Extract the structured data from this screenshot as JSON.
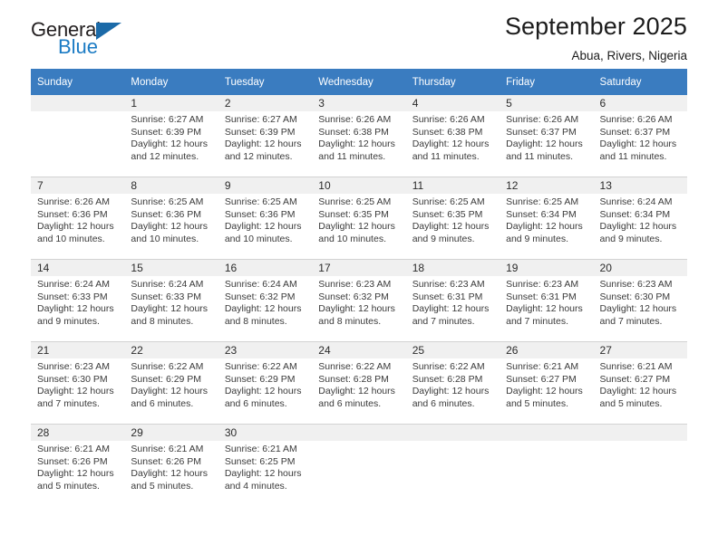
{
  "brand": {
    "name_top": "General",
    "name_bottom": "Blue",
    "accent_color": "#1b7bc4",
    "triangle_color": "#1b6aa8"
  },
  "header": {
    "title": "September 2025",
    "subtitle": "Abua, Rivers, Nigeria"
  },
  "theme": {
    "header_row_color": "#3a7cc0",
    "daynum_band_color": "#f0f0f0",
    "grid_line_color": "#d2d2d2",
    "text_color": "#2b2b2b"
  },
  "weekday_headers": [
    "Sunday",
    "Monday",
    "Tuesday",
    "Wednesday",
    "Thursday",
    "Friday",
    "Saturday"
  ],
  "labels": {
    "sunrise_prefix": "Sunrise:",
    "sunset_prefix": "Sunset:",
    "daylight_prefix": "Daylight:"
  },
  "weeks": [
    [
      {
        "day": "",
        "sunrise": "",
        "sunset": "",
        "daylight_line1": "",
        "daylight_line2": ""
      },
      {
        "day": "1",
        "sunrise": "Sunrise: 6:27 AM",
        "sunset": "Sunset: 6:39 PM",
        "daylight_line1": "Daylight: 12 hours",
        "daylight_line2": "and 12 minutes."
      },
      {
        "day": "2",
        "sunrise": "Sunrise: 6:27 AM",
        "sunset": "Sunset: 6:39 PM",
        "daylight_line1": "Daylight: 12 hours",
        "daylight_line2": "and 12 minutes."
      },
      {
        "day": "3",
        "sunrise": "Sunrise: 6:26 AM",
        "sunset": "Sunset: 6:38 PM",
        "daylight_line1": "Daylight: 12 hours",
        "daylight_line2": "and 11 minutes."
      },
      {
        "day": "4",
        "sunrise": "Sunrise: 6:26 AM",
        "sunset": "Sunset: 6:38 PM",
        "daylight_line1": "Daylight: 12 hours",
        "daylight_line2": "and 11 minutes."
      },
      {
        "day": "5",
        "sunrise": "Sunrise: 6:26 AM",
        "sunset": "Sunset: 6:37 PM",
        "daylight_line1": "Daylight: 12 hours",
        "daylight_line2": "and 11 minutes."
      },
      {
        "day": "6",
        "sunrise": "Sunrise: 6:26 AM",
        "sunset": "Sunset: 6:37 PM",
        "daylight_line1": "Daylight: 12 hours",
        "daylight_line2": "and 11 minutes."
      }
    ],
    [
      {
        "day": "7",
        "sunrise": "Sunrise: 6:26 AM",
        "sunset": "Sunset: 6:36 PM",
        "daylight_line1": "Daylight: 12 hours",
        "daylight_line2": "and 10 minutes."
      },
      {
        "day": "8",
        "sunrise": "Sunrise: 6:25 AM",
        "sunset": "Sunset: 6:36 PM",
        "daylight_line1": "Daylight: 12 hours",
        "daylight_line2": "and 10 minutes."
      },
      {
        "day": "9",
        "sunrise": "Sunrise: 6:25 AM",
        "sunset": "Sunset: 6:36 PM",
        "daylight_line1": "Daylight: 12 hours",
        "daylight_line2": "and 10 minutes."
      },
      {
        "day": "10",
        "sunrise": "Sunrise: 6:25 AM",
        "sunset": "Sunset: 6:35 PM",
        "daylight_line1": "Daylight: 12 hours",
        "daylight_line2": "and 10 minutes."
      },
      {
        "day": "11",
        "sunrise": "Sunrise: 6:25 AM",
        "sunset": "Sunset: 6:35 PM",
        "daylight_line1": "Daylight: 12 hours",
        "daylight_line2": "and 9 minutes."
      },
      {
        "day": "12",
        "sunrise": "Sunrise: 6:25 AM",
        "sunset": "Sunset: 6:34 PM",
        "daylight_line1": "Daylight: 12 hours",
        "daylight_line2": "and 9 minutes."
      },
      {
        "day": "13",
        "sunrise": "Sunrise: 6:24 AM",
        "sunset": "Sunset: 6:34 PM",
        "daylight_line1": "Daylight: 12 hours",
        "daylight_line2": "and 9 minutes."
      }
    ],
    [
      {
        "day": "14",
        "sunrise": "Sunrise: 6:24 AM",
        "sunset": "Sunset: 6:33 PM",
        "daylight_line1": "Daylight: 12 hours",
        "daylight_line2": "and 9 minutes."
      },
      {
        "day": "15",
        "sunrise": "Sunrise: 6:24 AM",
        "sunset": "Sunset: 6:33 PM",
        "daylight_line1": "Daylight: 12 hours",
        "daylight_line2": "and 8 minutes."
      },
      {
        "day": "16",
        "sunrise": "Sunrise: 6:24 AM",
        "sunset": "Sunset: 6:32 PM",
        "daylight_line1": "Daylight: 12 hours",
        "daylight_line2": "and 8 minutes."
      },
      {
        "day": "17",
        "sunrise": "Sunrise: 6:23 AM",
        "sunset": "Sunset: 6:32 PM",
        "daylight_line1": "Daylight: 12 hours",
        "daylight_line2": "and 8 minutes."
      },
      {
        "day": "18",
        "sunrise": "Sunrise: 6:23 AM",
        "sunset": "Sunset: 6:31 PM",
        "daylight_line1": "Daylight: 12 hours",
        "daylight_line2": "and 7 minutes."
      },
      {
        "day": "19",
        "sunrise": "Sunrise: 6:23 AM",
        "sunset": "Sunset: 6:31 PM",
        "daylight_line1": "Daylight: 12 hours",
        "daylight_line2": "and 7 minutes."
      },
      {
        "day": "20",
        "sunrise": "Sunrise: 6:23 AM",
        "sunset": "Sunset: 6:30 PM",
        "daylight_line1": "Daylight: 12 hours",
        "daylight_line2": "and 7 minutes."
      }
    ],
    [
      {
        "day": "21",
        "sunrise": "Sunrise: 6:23 AM",
        "sunset": "Sunset: 6:30 PM",
        "daylight_line1": "Daylight: 12 hours",
        "daylight_line2": "and 7 minutes."
      },
      {
        "day": "22",
        "sunrise": "Sunrise: 6:22 AM",
        "sunset": "Sunset: 6:29 PM",
        "daylight_line1": "Daylight: 12 hours",
        "daylight_line2": "and 6 minutes."
      },
      {
        "day": "23",
        "sunrise": "Sunrise: 6:22 AM",
        "sunset": "Sunset: 6:29 PM",
        "daylight_line1": "Daylight: 12 hours",
        "daylight_line2": "and 6 minutes."
      },
      {
        "day": "24",
        "sunrise": "Sunrise: 6:22 AM",
        "sunset": "Sunset: 6:28 PM",
        "daylight_line1": "Daylight: 12 hours",
        "daylight_line2": "and 6 minutes."
      },
      {
        "day": "25",
        "sunrise": "Sunrise: 6:22 AM",
        "sunset": "Sunset: 6:28 PM",
        "daylight_line1": "Daylight: 12 hours",
        "daylight_line2": "and 6 minutes."
      },
      {
        "day": "26",
        "sunrise": "Sunrise: 6:21 AM",
        "sunset": "Sunset: 6:27 PM",
        "daylight_line1": "Daylight: 12 hours",
        "daylight_line2": "and 5 minutes."
      },
      {
        "day": "27",
        "sunrise": "Sunrise: 6:21 AM",
        "sunset": "Sunset: 6:27 PM",
        "daylight_line1": "Daylight: 12 hours",
        "daylight_line2": "and 5 minutes."
      }
    ],
    [
      {
        "day": "28",
        "sunrise": "Sunrise: 6:21 AM",
        "sunset": "Sunset: 6:26 PM",
        "daylight_line1": "Daylight: 12 hours",
        "daylight_line2": "and 5 minutes."
      },
      {
        "day": "29",
        "sunrise": "Sunrise: 6:21 AM",
        "sunset": "Sunset: 6:26 PM",
        "daylight_line1": "Daylight: 12 hours",
        "daylight_line2": "and 5 minutes."
      },
      {
        "day": "30",
        "sunrise": "Sunrise: 6:21 AM",
        "sunset": "Sunset: 6:25 PM",
        "daylight_line1": "Daylight: 12 hours",
        "daylight_line2": "and 4 minutes."
      },
      {
        "day": "",
        "sunrise": "",
        "sunset": "",
        "daylight_line1": "",
        "daylight_line2": ""
      },
      {
        "day": "",
        "sunrise": "",
        "sunset": "",
        "daylight_line1": "",
        "daylight_line2": ""
      },
      {
        "day": "",
        "sunrise": "",
        "sunset": "",
        "daylight_line1": "",
        "daylight_line2": ""
      },
      {
        "day": "",
        "sunrise": "",
        "sunset": "",
        "daylight_line1": "",
        "daylight_line2": ""
      }
    ]
  ]
}
